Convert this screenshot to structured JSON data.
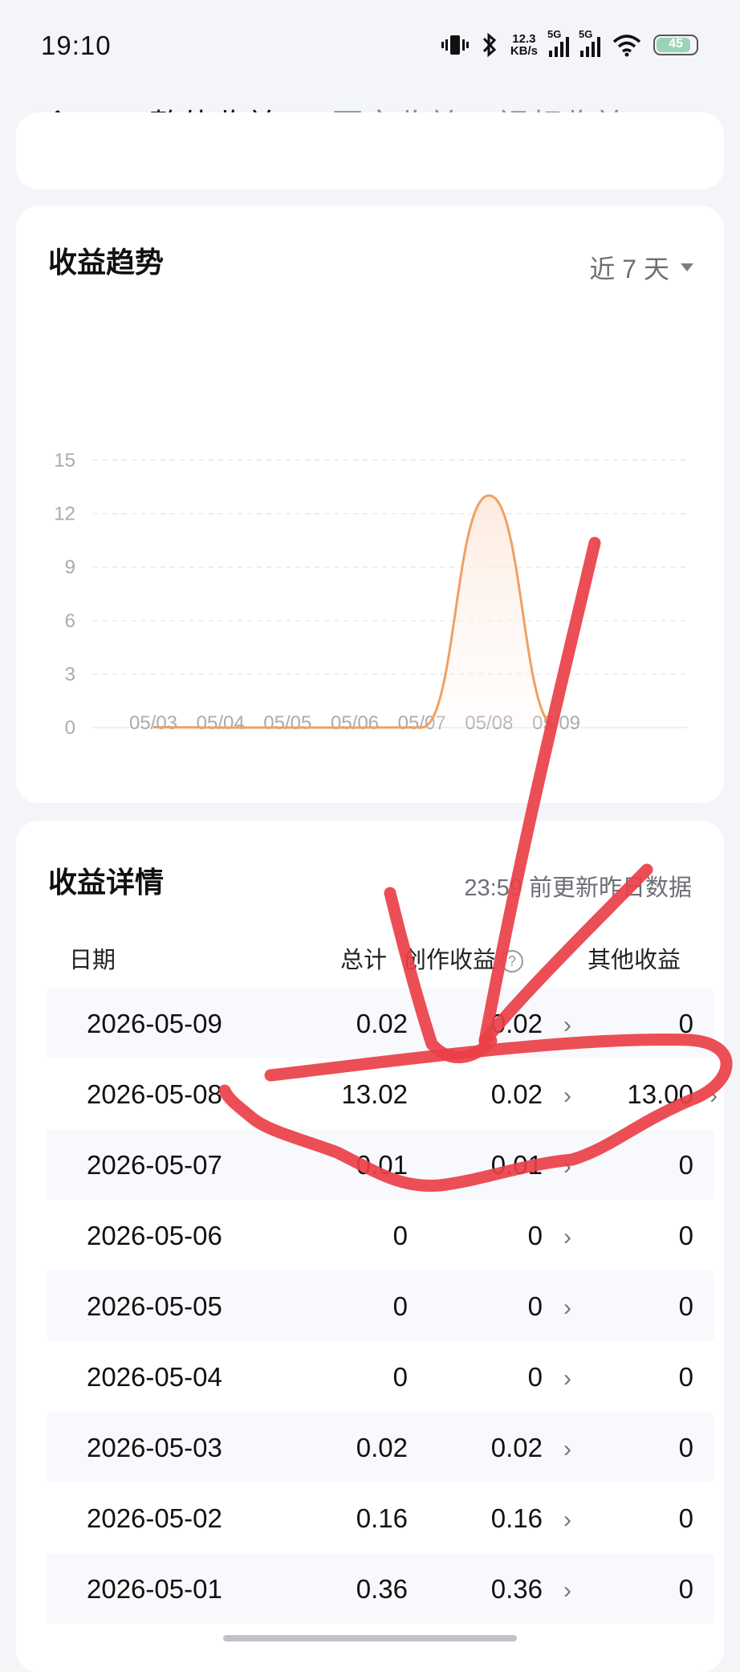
{
  "status_bar": {
    "time": "19:10",
    "net_speed_value": "12.3",
    "net_speed_unit": "KB/s",
    "sim1_label": "5G",
    "sim2_label": "5G",
    "battery": "45",
    "icons": [
      "vibrate-icon",
      "bluetooth-icon",
      "signal-icon",
      "wifi-icon",
      "battery-icon"
    ]
  },
  "header": {
    "tabs": [
      {
        "label": "整体收益",
        "active": true
      },
      {
        "label": "图文收益",
        "active": false
      },
      {
        "label": "视频收益",
        "active": false
      }
    ]
  },
  "trend": {
    "title": "收益趋势",
    "range_label": "近 7 天",
    "accent_color": "#f0a062"
  },
  "chart_data": {
    "type": "area",
    "title": "收益趋势",
    "x": [
      "05/03",
      "05/04",
      "05/05",
      "05/06",
      "05/07",
      "05/08",
      "05/09"
    ],
    "series": [
      {
        "values": [
          0.02,
          0,
          0,
          0,
          0.01,
          13.02,
          0.02
        ]
      }
    ],
    "yticks": [
      "0",
      "3",
      "6",
      "9",
      "12",
      "15"
    ],
    "ylim": [
      0,
      15
    ],
    "grid": true
  },
  "detail": {
    "title": "收益详情",
    "update_text": "23:59 前更新昨日数据",
    "columns": [
      "日期",
      "总计",
      "创作收益",
      "其他收益"
    ],
    "help_icon": "?",
    "rows": [
      {
        "date": "2026-05-09",
        "total": "0.02",
        "create": "0.02",
        "other": "0",
        "other_link": false
      },
      {
        "date": "2026-05-08",
        "total": "13.02",
        "create": "0.02",
        "other": "13.00",
        "other_link": true
      },
      {
        "date": "2026-05-07",
        "total": "0.01",
        "create": "0.01",
        "other": "0",
        "other_link": false
      },
      {
        "date": "2026-05-06",
        "total": "0",
        "create": "0",
        "other": "0",
        "other_link": false
      },
      {
        "date": "2026-05-05",
        "total": "0",
        "create": "0",
        "other": "0",
        "other_link": false
      },
      {
        "date": "2026-05-04",
        "total": "0",
        "create": "0",
        "other": "0",
        "other_link": false
      },
      {
        "date": "2026-05-03",
        "total": "0.02",
        "create": "0.02",
        "other": "0",
        "other_link": false
      },
      {
        "date": "2026-05-02",
        "total": "0.16",
        "create": "0.16",
        "other": "0",
        "other_link": false
      },
      {
        "date": "2026-05-01",
        "total": "0.36",
        "create": "0.36",
        "other": "0",
        "other_link": false
      }
    ]
  },
  "annotation": {
    "color": "#ea3f46"
  }
}
